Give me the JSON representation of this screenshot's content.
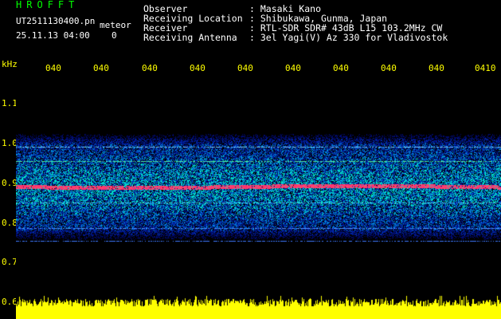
{
  "header": {
    "logo": "HROFFT",
    "filename": "UT2511130400.pn",
    "type_label": "meteor",
    "datetime": "25.11.13 04:00",
    "count": "0",
    "fields": [
      {
        "key": "Observer",
        "value": ": Masaki Kano"
      },
      {
        "key": "Receiving Location",
        "value": ": Shibukawa, Gunma, Japan"
      },
      {
        "key": "Receiver",
        "value": ": RTL-SDR SDR# 43dB L15 103.2MHz CW"
      },
      {
        "key": "Receiving Antenna",
        "value": ": 3el Yagi(V) Az 330 for Vladivostok"
      }
    ]
  },
  "axes": {
    "y_unit": "kHz",
    "y_ticks": [
      "1.1",
      "1.0",
      "0.9",
      "0.8",
      "0.7",
      "0.6"
    ],
    "x_ticks": [
      "040",
      "040",
      "040",
      "040",
      "040",
      "040",
      "040",
      "040",
      "040",
      "0410"
    ]
  },
  "colors": {
    "background": "#000000",
    "axis_text": "#ffff00",
    "logo": "#00ff00",
    "signal_line": "#ff2060",
    "noise_floor": "#ffff00"
  }
}
